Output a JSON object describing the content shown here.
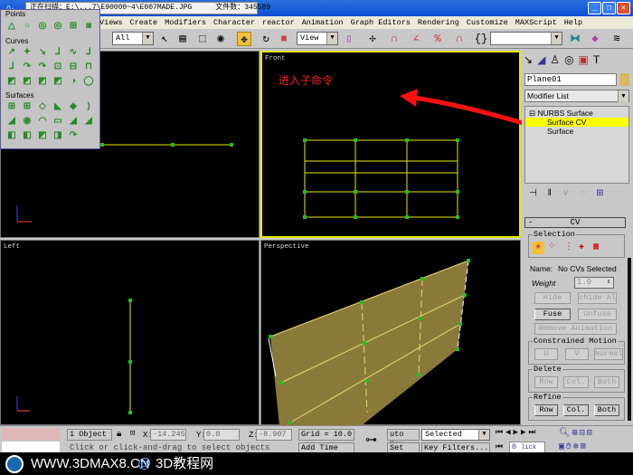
{
  "titlebar": {
    "scan_text": "正在扫描：E:\\...7\\E90000~4\\E007MADE.JPG",
    "file_count_label": "文件数：",
    "file_count": "345589"
  },
  "menu": [
    "Views",
    "Create",
    "Modifiers",
    "Character",
    "reactor",
    "Animation",
    "Graph Editors",
    "Rendering",
    "Customize",
    "MAXScript",
    "Help"
  ],
  "toolbar": {
    "selection_filter": "All",
    "ref_coord": "View",
    "named_selection": ""
  },
  "nurbs_toolbox": {
    "sections": [
      "Points",
      "Curves",
      "Surfaces"
    ]
  },
  "viewports": {
    "top": "",
    "front": "Front",
    "left": "Left",
    "perspective": "Perspective"
  },
  "annotation": {
    "text": "进入子命令",
    "color": "#ff2020"
  },
  "command_panel": {
    "object_name": "Plane01",
    "modifier_list": "Modifier List",
    "stack": [
      "NURBS Surface",
      "Surface CV",
      "Surface"
    ],
    "rollout_title": "CV",
    "minus": "-",
    "selection_label": "Selection",
    "name_label": "Name:",
    "name_value": "No CVs Selected",
    "weight_label": "Weight",
    "weight_value": "1.0",
    "buttons": {
      "hide": "Hide",
      "unhide_all": "nhide Al",
      "fuse": "Fuse",
      "unfuse": "Unfuse",
      "remove_animation": "Remove Animation"
    },
    "constrained_motion": {
      "label": "Constrained Motion",
      "u": "U",
      "v": "V",
      "normal": "Normal"
    },
    "delete": {
      "label": "Delete",
      "row": "Row",
      "col": "Col.",
      "both": "Both"
    },
    "refine": {
      "label": "Refine",
      "row": "Row",
      "col": "Col.",
      "both": "Both"
    }
  },
  "status": {
    "selection_count": "1 Object",
    "x_label": "X:",
    "x": "-14.245",
    "y_label": "Y:",
    "y": "0.0",
    "z_label": "Z:",
    "z": "-8.907",
    "grid": "Grid = 10.0",
    "auto_key": "uto Key",
    "key_mode": "Selected",
    "set_key": "Set Key",
    "key_filters": "Key Filters...",
    "prompt": "Click or click-and-drag to select objects",
    "add_time_tag": "Add Time Tag",
    "frame": "0",
    "click_to": "lick to scr"
  },
  "watermark": {
    "site": "WWW.3DMAX8.CN",
    "at": "@",
    "name": "3D教程网"
  },
  "colors": {
    "active_border": "#e8e800",
    "surface": "#8a7a3a",
    "cv_point": "#20c020",
    "highlight": "#ffff00"
  }
}
